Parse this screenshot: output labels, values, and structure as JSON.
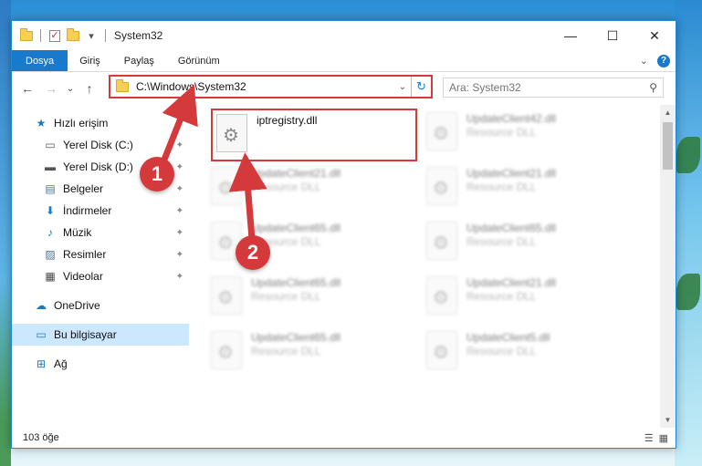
{
  "window": {
    "title": "System32",
    "controls": {
      "minimize": "—",
      "maximize": "☐",
      "close": "✕"
    }
  },
  "ribbon": {
    "tabs": [
      "Dosya",
      "Giriş",
      "Paylaş",
      "Görünüm"
    ],
    "expand": "⌄",
    "help": "?"
  },
  "nav": {
    "back": "←",
    "forward": "→",
    "dropdown": "⌄",
    "up": "↑",
    "address": "C:\\Windows\\System32",
    "address_dd": "⌄",
    "refresh": "↻",
    "search_placeholder": "Ara: System32",
    "search_icon": "⚲"
  },
  "sidebar": {
    "quick_access": "Hızlı erişim",
    "items": [
      {
        "label": "Yerel Disk (C:)",
        "icon": "drive-icon",
        "glyph": "▭"
      },
      {
        "label": "Yerel Disk (D:)",
        "icon": "drive-icon",
        "glyph": "▬"
      },
      {
        "label": "Belgeler",
        "icon": "documents-icon",
        "glyph": "▤"
      },
      {
        "label": "İndirmeler",
        "icon": "downloads-icon",
        "glyph": "⬇"
      },
      {
        "label": "Müzik",
        "icon": "music-icon",
        "glyph": "♪"
      },
      {
        "label": "Resimler",
        "icon": "pictures-icon",
        "glyph": "▨"
      },
      {
        "label": "Videolar",
        "icon": "videos-icon",
        "glyph": "▦"
      }
    ],
    "onedrive": "OneDrive",
    "this_pc": "Bu bilgisayar",
    "network": "Ağ",
    "pin": "📌"
  },
  "files": {
    "highlighted": {
      "name": "iptregistry.dll"
    },
    "others": [
      {
        "name": "UpdateClient42.dll",
        "type": "Resource DLL"
      },
      {
        "name": "UpdateClient21.dll",
        "type": "Resource DLL"
      },
      {
        "name": "UpdateClient21.dll",
        "type": "Resource DLL"
      },
      {
        "name": "UpdateClient65.dll",
        "type": "Resource DLL"
      },
      {
        "name": "UpdateClient65.dll",
        "type": "Resource DLL"
      },
      {
        "name": "UpdateClient65.dll",
        "type": "Resource DLL"
      },
      {
        "name": "UpdateClient21.dll",
        "type": "Resource DLL"
      },
      {
        "name": "UpdateClient65.dll",
        "type": "Resource DLL"
      },
      {
        "name": "UpdateClient5.dll",
        "type": "Resource DLL"
      }
    ]
  },
  "status": {
    "count": "103 öğe",
    "view_details": "☰",
    "view_tiles": "▦"
  },
  "annotations": [
    "1",
    "2"
  ],
  "colors": {
    "accent": "#1979ca",
    "highlight_red": "#d4393c",
    "selected_bg": "#cce8ff"
  }
}
